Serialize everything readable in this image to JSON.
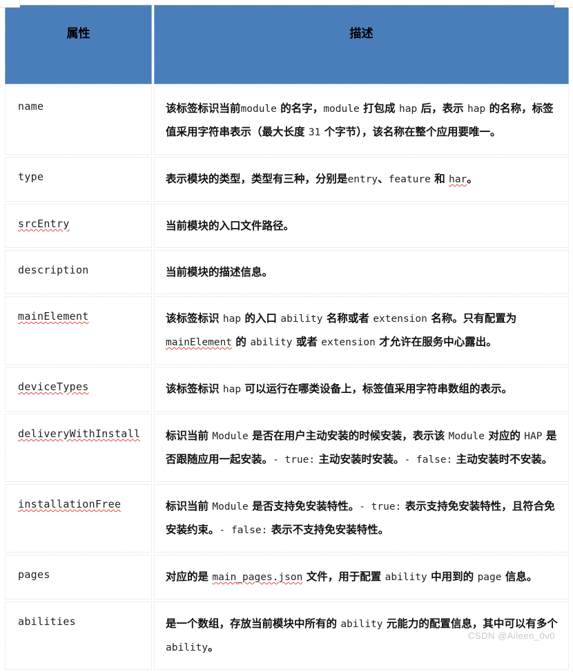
{
  "document": {
    "kind": "attribute-description-table",
    "language": "zh-CN"
  },
  "colors": {
    "header_background": "#4a7ebb",
    "header_text": "#000000",
    "cell_background": "#ffffff",
    "cell_border": "#dcdcdc",
    "spellcheck_underline": "#e8453c",
    "watermark_text": "#c9c9c9"
  },
  "table": {
    "headers": {
      "attribute": "属性",
      "description": "描述"
    },
    "rows": [
      {
        "attribute": "name",
        "attribute_spellchecked": false,
        "description_segments": [
          {
            "t": "该标签标识当前",
            "code": false
          },
          {
            "t": "module",
            "code": true
          },
          {
            "t": " 的名字，",
            "code": false
          },
          {
            "t": "module",
            "code": true
          },
          {
            "t": " 打包成 ",
            "code": false
          },
          {
            "t": "hap",
            "code": true
          },
          {
            "t": " 后，表示 ",
            "code": false
          },
          {
            "t": "hap",
            "code": true
          },
          {
            "t": " 的名称，标签值采用字符串表示（最大长度 ",
            "code": false
          },
          {
            "t": "31",
            "code": true
          },
          {
            "t": " 个字节），该名称在整个应用要唯一。",
            "code": false
          }
        ],
        "description_plain": "该标签标识当前module 的名字，module 打包成 hap 后，表示 hap 的名称，标签值采用字符串表示（最大长度 31 个字节），该名称在整个应用要唯一。"
      },
      {
        "attribute": "type",
        "attribute_spellchecked": false,
        "description_segments": [
          {
            "t": "表示模块的类型，类型有三种，分别是",
            "code": false
          },
          {
            "t": "entry",
            "code": true
          },
          {
            "t": "、",
            "code": false
          },
          {
            "t": "feature",
            "code": true
          },
          {
            "t": " 和 ",
            "code": false
          },
          {
            "t": "har",
            "code": true,
            "sp": true
          },
          {
            "t": "。",
            "code": false
          }
        ],
        "description_plain": "表示模块的类型，类型有三种，分别是entry、feature 和 har。"
      },
      {
        "attribute": "srcEntry",
        "attribute_spellchecked": true,
        "description_segments": [
          {
            "t": "当前模块的入口文件路径。",
            "code": false
          }
        ],
        "description_plain": "当前模块的入口文件路径。"
      },
      {
        "attribute": "description",
        "attribute_spellchecked": false,
        "description_segments": [
          {
            "t": "当前模块的描述信息。",
            "code": false
          }
        ],
        "description_plain": "当前模块的描述信息。"
      },
      {
        "attribute": "mainElement",
        "attribute_spellchecked": true,
        "description_segments": [
          {
            "t": "该标签标识 ",
            "code": false
          },
          {
            "t": "hap",
            "code": true
          },
          {
            "t": " 的入口 ",
            "code": false
          },
          {
            "t": "ability",
            "code": true
          },
          {
            "t": " 名称或者 ",
            "code": false
          },
          {
            "t": "extension",
            "code": true
          },
          {
            "t": " 名称。只有配置为 ",
            "code": false
          },
          {
            "t": "mainElement",
            "code": true,
            "sp": true
          },
          {
            "t": " 的 ",
            "code": false
          },
          {
            "t": "ability",
            "code": true
          },
          {
            "t": " 或者 ",
            "code": false
          },
          {
            "t": "extension",
            "code": true
          },
          {
            "t": " 才允许在服务中心露出。",
            "code": false
          }
        ],
        "description_plain": "该标签标识 hap 的入口 ability 名称或者 extension 名称。只有配置为 mainElement 的 ability 或者 extension 才允许在服务中心露出。"
      },
      {
        "attribute": "deviceTypes",
        "attribute_spellchecked": true,
        "description_segments": [
          {
            "t": "该标签标识 ",
            "code": false
          },
          {
            "t": "hap",
            "code": true
          },
          {
            "t": " 可以运行在哪类设备上，标签值采用字符串数组的表示。",
            "code": false
          }
        ],
        "description_plain": "该标签标识 hap 可以运行在哪类设备上，标签值采用字符串数组的表示。"
      },
      {
        "attribute": "deliveryWithInstall",
        "attribute_spellchecked": true,
        "description_segments": [
          {
            "t": "标识当前 ",
            "code": false
          },
          {
            "t": "Module",
            "code": true
          },
          {
            "t": " 是否在用户主动安装的时候安装，表示该 ",
            "code": false
          },
          {
            "t": "Module",
            "code": true
          },
          {
            "t": " 对应的 ",
            "code": false
          },
          {
            "t": "HAP",
            "code": true
          },
          {
            "t": " 是否跟随应用一起安装。",
            "code": false
          },
          {
            "t": "- true:",
            "code": true
          },
          {
            "t": " 主动安装时安装。",
            "code": false
          },
          {
            "t": "- false:",
            "code": true
          },
          {
            "t": " 主动安装时不安装。",
            "code": false
          }
        ],
        "description_plain": "标识当前 Module 是否在用户主动安装的时候安装，表示该 Module 对应的 HAP 是否跟随应用一起安装。- true: 主动安装时安装。- false: 主动安装时不安装。"
      },
      {
        "attribute": "installationFree",
        "attribute_spellchecked": true,
        "description_segments": [
          {
            "t": "标识当前 ",
            "code": false
          },
          {
            "t": "Module",
            "code": true
          },
          {
            "t": " 是否支持免安装特性。",
            "code": false
          },
          {
            "t": "- true:",
            "code": true
          },
          {
            "t": " 表示支持免安装特性，且符合免安装约束。",
            "code": false
          },
          {
            "t": "- false:",
            "code": true
          },
          {
            "t": " 表示不支持免安装特性。",
            "code": false
          }
        ],
        "description_plain": "标识当前 Module 是否支持免安装特性。- true: 表示支持免安装特性，且符合免安装约束。- false: 表示不支持免安装特性。"
      },
      {
        "attribute": "pages",
        "attribute_spellchecked": false,
        "description_segments": [
          {
            "t": "对应的是 ",
            "code": false
          },
          {
            "t": "main_pages.json",
            "code": true,
            "sp": true
          },
          {
            "t": " 文件，用于配置 ",
            "code": false
          },
          {
            "t": "ability",
            "code": true
          },
          {
            "t": " 中用到的 ",
            "code": false
          },
          {
            "t": "page",
            "code": true
          },
          {
            "t": " 信息。",
            "code": false
          }
        ],
        "description_plain": "对应的是 main_pages.json 文件，用于配置 ability 中用到的 page 信息。"
      },
      {
        "attribute": "abilities",
        "attribute_spellchecked": false,
        "description_segments": [
          {
            "t": "是一个数组，存放当前模块中所有的 ",
            "code": false
          },
          {
            "t": "ability",
            "code": true
          },
          {
            "t": " 元能力的配置信息，其中可以有多个 ",
            "code": false
          },
          {
            "t": "ability",
            "code": true
          },
          {
            "t": "。",
            "code": false
          }
        ],
        "description_plain": "是一个数组，存放当前模块中所有的 ability 元能力的配置信息，其中可以有多个 ability。"
      }
    ]
  },
  "watermark": {
    "text": "CSDN @Aileen_0v0"
  }
}
